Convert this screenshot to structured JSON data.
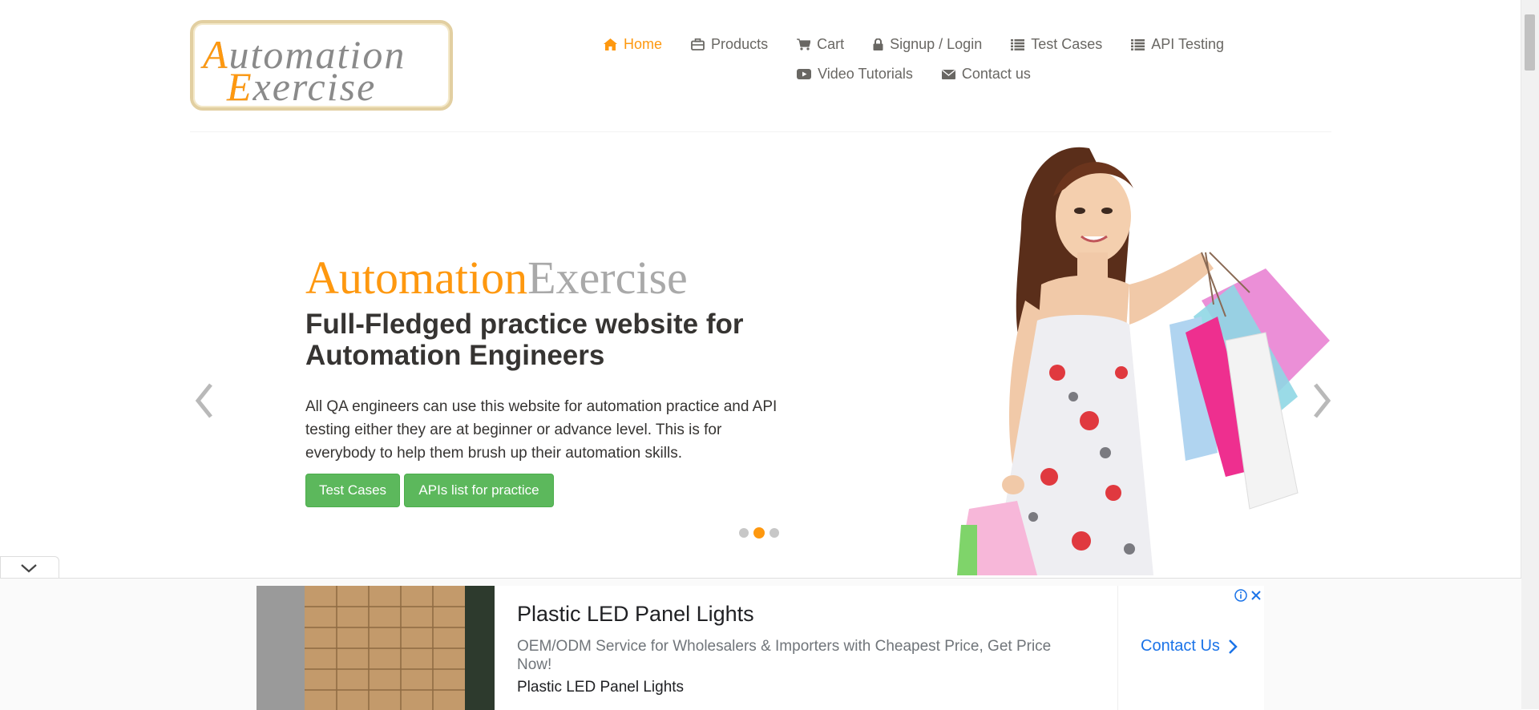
{
  "logo": {
    "line1": "Automation",
    "line2": "Exercise"
  },
  "nav": {
    "row1": [
      {
        "label": "Home",
        "icon": "home-icon",
        "active": true
      },
      {
        "label": "Products",
        "icon": "briefcase-icon"
      },
      {
        "label": "Cart",
        "icon": "cart-icon"
      },
      {
        "label": "Signup / Login",
        "icon": "lock-icon"
      },
      {
        "label": "Test Cases",
        "icon": "list-icon"
      },
      {
        "label": "API Testing",
        "icon": "list-icon"
      }
    ],
    "row2": [
      {
        "label": "Video Tutorials",
        "icon": "youtube-play-icon"
      },
      {
        "label": "Contact us",
        "icon": "envelope-icon"
      }
    ]
  },
  "slider": {
    "brand_a": "Automation",
    "brand_e": "Exercise",
    "headline": "Full-Fledged practice website for Automation Engineers",
    "description": "All QA engineers can use this website for automation practice and API testing either they are at beginner or advance level. This is for everybody to help them brush up their automation skills.",
    "btn_test_cases": "Test Cases",
    "btn_apis": "APIs list for practice",
    "active_slide": 2,
    "slide_count": 3
  },
  "ad": {
    "title": "Plastic LED Panel Lights",
    "text": "OEM/ODM Service for Wholesalers & Importers with Cheapest Price, Get Price Now!",
    "sub": "Plastic LED Panel Lights",
    "cta": "Contact Us"
  },
  "colors": {
    "accent": "#fe980f",
    "button": "#5cb85c",
    "text": "#696763",
    "link": "#1a73e8"
  }
}
